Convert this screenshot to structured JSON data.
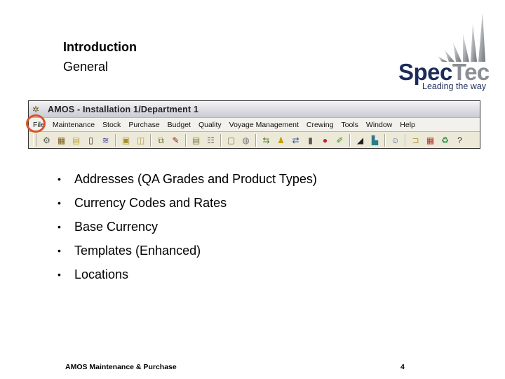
{
  "slide": {
    "title": "Introduction",
    "subtitle": "General",
    "footer": "AMOS Maintenance & Purchase",
    "page_number": "4"
  },
  "logo": {
    "brand_part1": "Spec",
    "brand_part2": "Tec",
    "tagline": "Leading the way",
    "colors": {
      "navy": "#1d2b5a",
      "grey": "#8a8f96"
    }
  },
  "app": {
    "window_title": "AMOS - Installation 1/Department 1",
    "app_icon": "amos-app-icon",
    "menu": [
      {
        "label": "File",
        "highlighted": true
      },
      {
        "label": "Maintenance"
      },
      {
        "label": "Stock"
      },
      {
        "label": "Purchase"
      },
      {
        "label": "Budget"
      },
      {
        "label": "Quality"
      },
      {
        "label": "Voyage Management"
      },
      {
        "label": "Crewing"
      },
      {
        "label": "Tools"
      },
      {
        "label": "Window"
      },
      {
        "label": "Help"
      }
    ],
    "toolbar_groups": [
      [
        "settings-icon",
        "components-icon",
        "list-icon",
        "document-icon",
        "structure-icon"
      ],
      [
        "folder-add-icon",
        "folder-open-icon"
      ],
      [
        "copy-windows-icon",
        "tools-icon"
      ],
      [
        "clipboard-icon",
        "clipboard-list-icon"
      ],
      [
        "clipboard-empty-icon",
        "stamp-icon"
      ],
      [
        "transfer-icon",
        "person-icon",
        "swap-icon",
        "bin-icon",
        "lock-icon",
        "paint-icon"
      ],
      [
        "ship-icon",
        "vessel-icon"
      ],
      [
        "crew-icon"
      ],
      [
        "folder-icon",
        "calendar-icon",
        "recycle-icon",
        "help-icon"
      ]
    ],
    "highlight_color": "#d9532a"
  },
  "bullets": [
    "Addresses (QA Grades and Product Types)",
    "Currency Codes and Rates",
    "Base Currency",
    "Templates (Enhanced)",
    "Locations"
  ]
}
